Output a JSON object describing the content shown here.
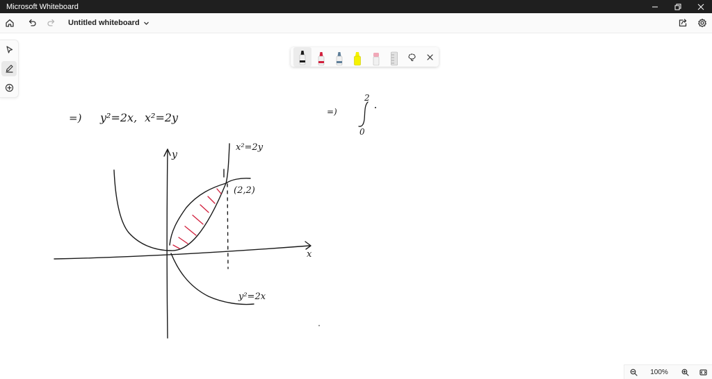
{
  "window": {
    "title": "Microsoft Whiteboard",
    "minimize_icon": "minimize-icon",
    "restore_icon": "restore-icon",
    "close_icon": "close-icon"
  },
  "toolbar": {
    "document_title": "Untitled whiteboard",
    "home_icon": "home-icon",
    "undo_icon": "undo-icon",
    "redo_icon": "redo-icon",
    "share_icon": "share-icon",
    "settings_icon": "gear-icon"
  },
  "side_rail": {
    "tools": [
      "select-icon",
      "pen-icon",
      "add-icon"
    ],
    "active_tool": "pen-icon"
  },
  "pen_tray": {
    "pens": [
      {
        "name": "black-pen",
        "color": "#1a1a1a",
        "selected": true
      },
      {
        "name": "red-pen",
        "color": "#d21f3c",
        "selected": false
      },
      {
        "name": "blue-pen",
        "color": "#5f7f99",
        "selected": false
      },
      {
        "name": "yellow-highlighter",
        "color": "#f5f200",
        "selected": false
      },
      {
        "name": "eraser",
        "color": "#f1a8b8",
        "selected": false
      },
      {
        "name": "ruler",
        "color": "#cfcfcf",
        "selected": false
      }
    ],
    "lasso_icon": "lasso-icon",
    "close_icon": "close-icon"
  },
  "ink_colors": {
    "black": "#1a1a1a",
    "red": "#d21f3c"
  },
  "handwriting": {
    "eq_arrow": "=)",
    "eq_y2": "y²=2x,",
    "eq_x2": "x²=2y",
    "label_x2": "x²=2y",
    "label_point": "(2,2)",
    "label_y2": "y²=2x",
    "axis_x": "x",
    "axis_y": "y",
    "right_arrow": "=)",
    "integral_upper": "2",
    "integral_lower": "0"
  },
  "zoom": {
    "level": "100%",
    "zoom_out_icon": "zoom-out-icon",
    "zoom_in_icon": "zoom-in-icon",
    "fit_icon": "fit-to-screen-icon"
  }
}
